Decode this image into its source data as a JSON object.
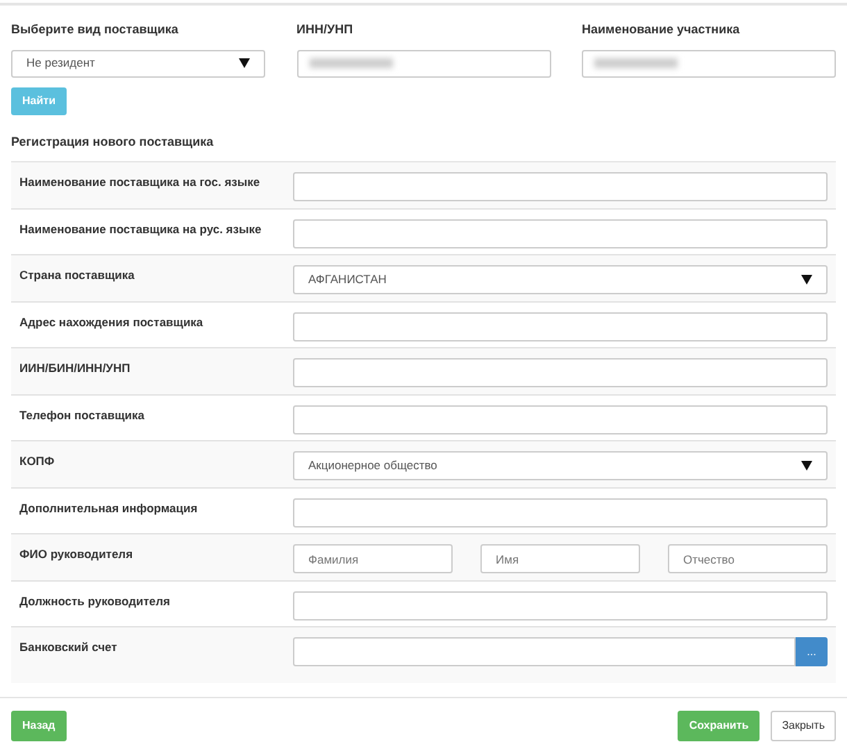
{
  "supplier_type": {
    "label": "Выберите вид поставщика",
    "value": "Не резидент"
  },
  "inn": {
    "label": "ИНН/УНП"
  },
  "participant": {
    "label": "Наименование участника"
  },
  "search_button": "Найти",
  "section_title": "Регистрация нового поставщика",
  "fields": [
    {
      "kind": "text",
      "label": "Наименование поставщика на гос. языке"
    },
    {
      "kind": "text",
      "label": "Наименование поставщика на рус. языке"
    },
    {
      "kind": "select",
      "label": "Страна поставщика",
      "value": "АФГАНИСТАН"
    },
    {
      "kind": "text",
      "label": "Адрес нахождения поставщика"
    },
    {
      "kind": "text",
      "label": "ИИН/БИН/ИНН/УНП"
    },
    {
      "kind": "text",
      "label": "Телефон поставщика"
    },
    {
      "kind": "select",
      "label": "КОПФ",
      "value": "Акционерное общество"
    },
    {
      "kind": "text",
      "label": "Дополнительная информация"
    },
    {
      "kind": "name",
      "label": "ФИО руководителя",
      "placeholders": [
        "Фамилия",
        "Имя",
        "Отчество"
      ]
    },
    {
      "kind": "text",
      "label": "Должность руководителя"
    },
    {
      "kind": "account",
      "label": "Банковский счет",
      "button": "..."
    }
  ],
  "buttons": {
    "back": "Назад",
    "save": "Сохранить",
    "close": "Закрыть"
  }
}
